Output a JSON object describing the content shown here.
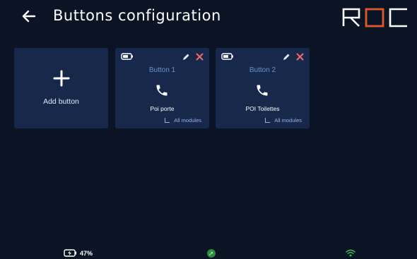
{
  "header": {
    "title": "Buttons configuration",
    "logo_text": "ROC"
  },
  "add_card": {
    "label": "Add button"
  },
  "buttons": [
    {
      "name": "Button 1",
      "poi": "Poi porte",
      "modules": "All modules",
      "icon": "phone-icon"
    },
    {
      "name": "Button 2",
      "poi": "POI Toilettes",
      "modules": "All modules",
      "icon": "phone-icon"
    }
  ],
  "status_bar": {
    "battery_percent": "47%",
    "battery_state": "charging"
  },
  "colors": {
    "background": "#0b1424",
    "card": "#16294a",
    "accent_orange": "#e2582b",
    "delete_red": "#f26b6b",
    "label_blue": "#6f8fd0",
    "link_blue": "#8fb4f2",
    "status_green": "#2e8b3e"
  }
}
